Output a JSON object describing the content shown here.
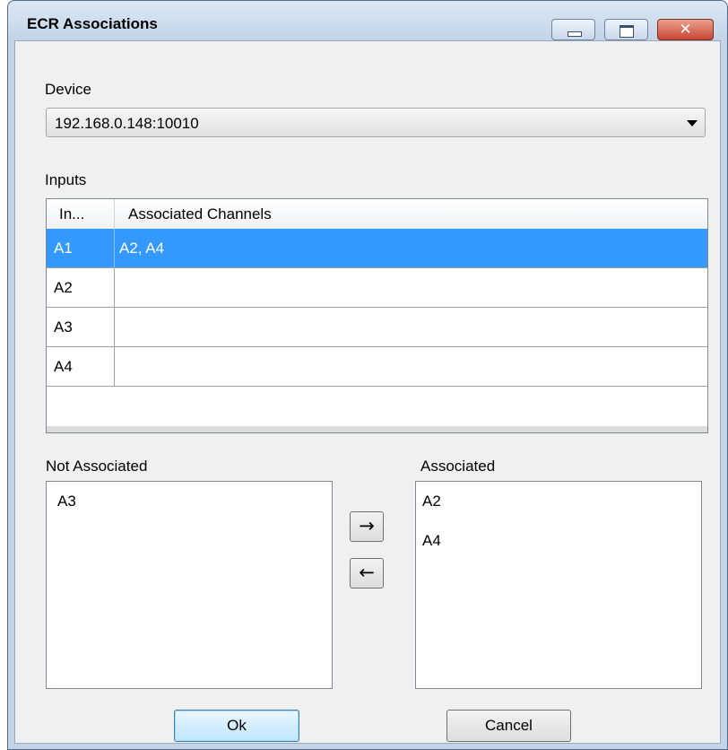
{
  "window": {
    "title": "ECR Associations",
    "close_glyph": "✕"
  },
  "device": {
    "label": "Device",
    "selected": "192.168.0.148:10010"
  },
  "inputs": {
    "label": "Inputs",
    "columns": [
      "In...",
      "Associated Channels"
    ],
    "rows": [
      {
        "input": "A1",
        "channels": "A2, A4",
        "selected": true
      },
      {
        "input": "A2",
        "channels": "",
        "selected": false
      },
      {
        "input": "A3",
        "channels": "",
        "selected": false
      },
      {
        "input": "A4",
        "channels": "",
        "selected": false
      }
    ]
  },
  "not_associated": {
    "label": "Not Associated",
    "items": [
      "A3"
    ]
  },
  "associated": {
    "label": "Associated",
    "items": [
      "A2",
      "A4"
    ]
  },
  "move_buttons": {
    "add": "→",
    "remove": "←"
  },
  "buttons": {
    "ok": "Ok",
    "cancel": "Cancel"
  },
  "colors": {
    "selection": "#3399ff",
    "frame": "#c3d4e7",
    "close_button": "#c84632"
  }
}
